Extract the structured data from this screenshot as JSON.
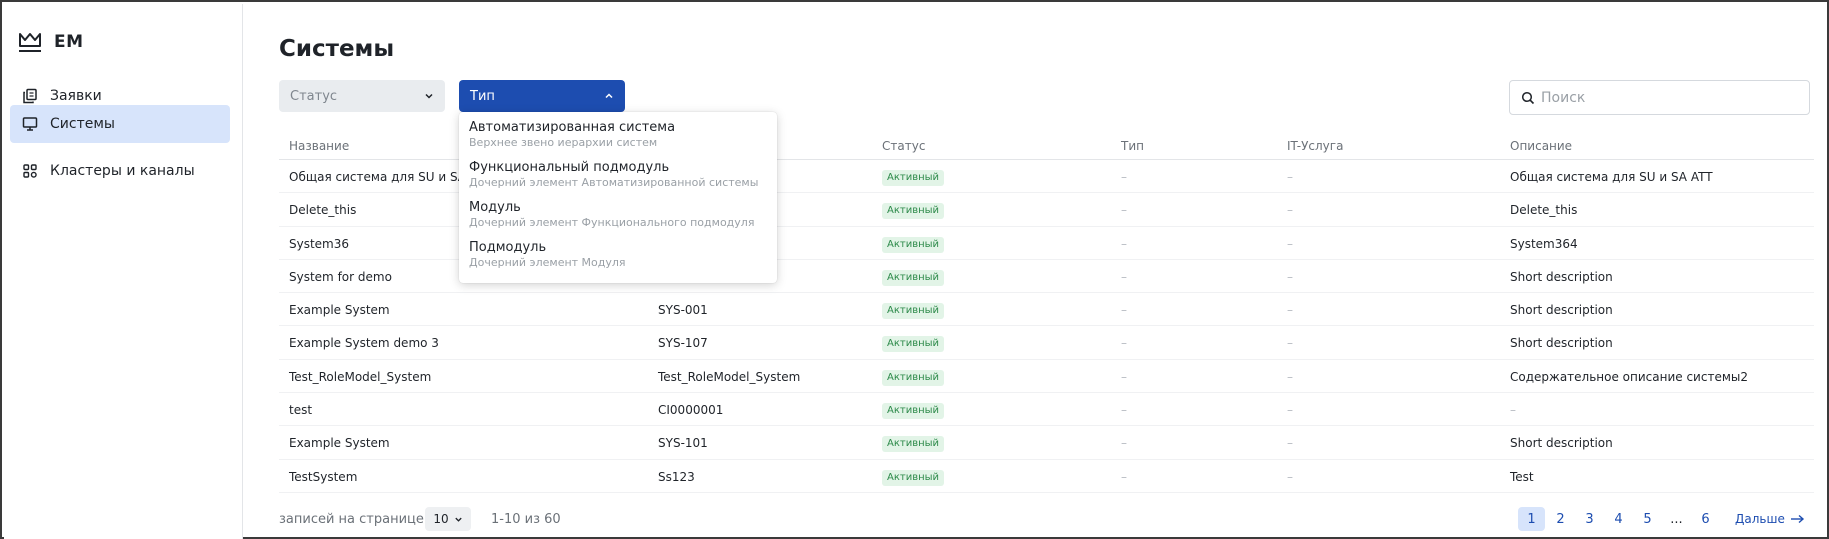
{
  "brand": {
    "name": "EM"
  },
  "sidebar": {
    "items": [
      {
        "label": "Заявки",
        "icon": "copy-icon",
        "active": false
      },
      {
        "label": "Системы",
        "icon": "monitor-icon",
        "active": true
      },
      {
        "label": "Кластеры и каналы",
        "icon": "grid-icon",
        "active": false
      }
    ]
  },
  "main": {
    "title": "Системы",
    "filters": {
      "status_label": "Статус",
      "type_label": "Тип"
    },
    "search": {
      "placeholder": "Поиск",
      "value": ""
    }
  },
  "dropdown": {
    "options": [
      {
        "title": "Автоматизированная система",
        "subtitle": "Верхнее звено иерархии систем"
      },
      {
        "title": "Функциональный подмодуль",
        "subtitle": "Дочерний элемент Автоматизированной системы"
      },
      {
        "title": "Модуль",
        "subtitle": "Дочерний элемент Функционального подмодуля"
      },
      {
        "title": "Подмодуль",
        "subtitle": "Дочерний элемент Модуля"
      }
    ]
  },
  "table": {
    "columns": {
      "name": "Название",
      "status": "Статус",
      "type": "Тип",
      "it_service": "IT-Услуга",
      "description": "Описание"
    },
    "rows": [
      {
        "name": "Общая система для SU и SA",
        "code": "",
        "status": "Активный",
        "type": "–",
        "it_service": "–",
        "description": "Общая система для SU и SA ATT"
      },
      {
        "name": "Delete_this",
        "code": "",
        "status": "Активный",
        "type": "–",
        "it_service": "–",
        "description": "Delete_this"
      },
      {
        "name": "System36",
        "code": "",
        "status": "Активный",
        "type": "–",
        "it_service": "–",
        "description": "System364"
      },
      {
        "name": "System for demo",
        "code": "",
        "status": "Активный",
        "type": "–",
        "it_service": "–",
        "description": "Short description"
      },
      {
        "name": "Example System",
        "code": "SYS-001",
        "status": "Активный",
        "type": "–",
        "it_service": "–",
        "description": "Short description"
      },
      {
        "name": "Example System demo 3",
        "code": "SYS-107",
        "status": "Активный",
        "type": "–",
        "it_service": "–",
        "description": "Short description"
      },
      {
        "name": "Test_RoleModel_System",
        "code": "Test_RoleModel_System",
        "status": "Активный",
        "type": "–",
        "it_service": "–",
        "description": "Содержательное описание системы2"
      },
      {
        "name": "test",
        "code": "CI0000001",
        "status": "Активный",
        "type": "–",
        "it_service": "–",
        "description": "–"
      },
      {
        "name": "Example System",
        "code": "SYS-101",
        "status": "Активный",
        "type": "–",
        "it_service": "–",
        "description": "Short description"
      },
      {
        "name": "TestSystem",
        "code": "Ss123",
        "status": "Активный",
        "type": "–",
        "it_service": "–",
        "description": "Test"
      }
    ]
  },
  "footer": {
    "per_page_label": "записей на странице",
    "per_page_value": "10",
    "range": "1-10 из 60",
    "pages": [
      "1",
      "2",
      "3",
      "4",
      "5",
      "...",
      "6"
    ],
    "current_page": "1",
    "next_label": "Дальше"
  },
  "colors": {
    "accent": "#1d4db0",
    "active_nav_bg": "#d7e4fb",
    "status_active_text": "#2d8a4a",
    "status_active_bg": "#e2f4e7"
  }
}
